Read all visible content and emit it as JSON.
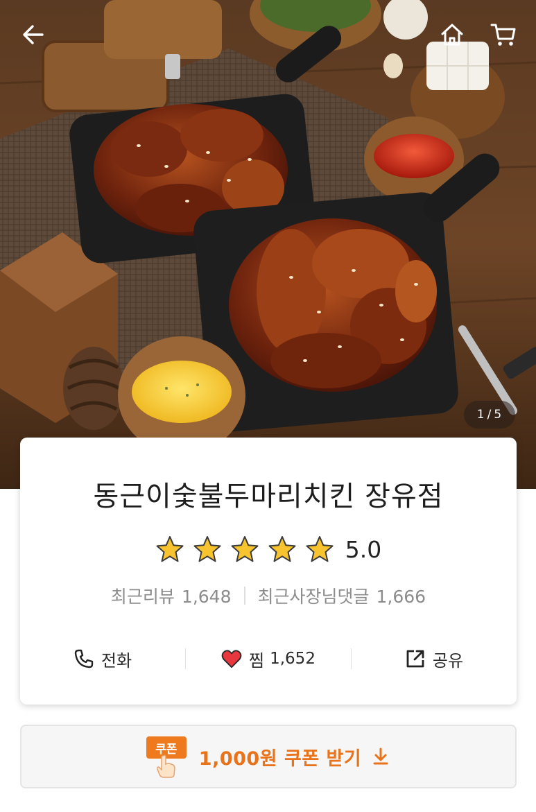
{
  "header": {
    "back_icon": "arrow-left-icon",
    "home_icon": "home-icon",
    "cart_icon": "cart-icon"
  },
  "gallery": {
    "current": "1",
    "separator": "/",
    "total": "5"
  },
  "store": {
    "name": "동근이숯불두마리치킨 장유점",
    "rating": "5.0",
    "stars_filled": 5,
    "stars_total": 5,
    "star_color": "#f7c32e",
    "recent_reviews_label": "최근리뷰",
    "recent_reviews_count": "1,648",
    "owner_replies_label": "최근사장님댓글",
    "owner_replies_count": "1,666"
  },
  "actions": {
    "call_label": "전화",
    "call_icon": "phone-icon",
    "like_label": "찜",
    "like_count": "1,652",
    "like_icon": "heart-icon",
    "like_color": "#e8383d",
    "share_label": "공유",
    "share_icon": "share-icon"
  },
  "coupon": {
    "badge_label": "쿠폰",
    "button_label": "1,000원 쿠폰 받기",
    "download_icon": "download-arrow-icon",
    "accent": "#e9731a"
  }
}
